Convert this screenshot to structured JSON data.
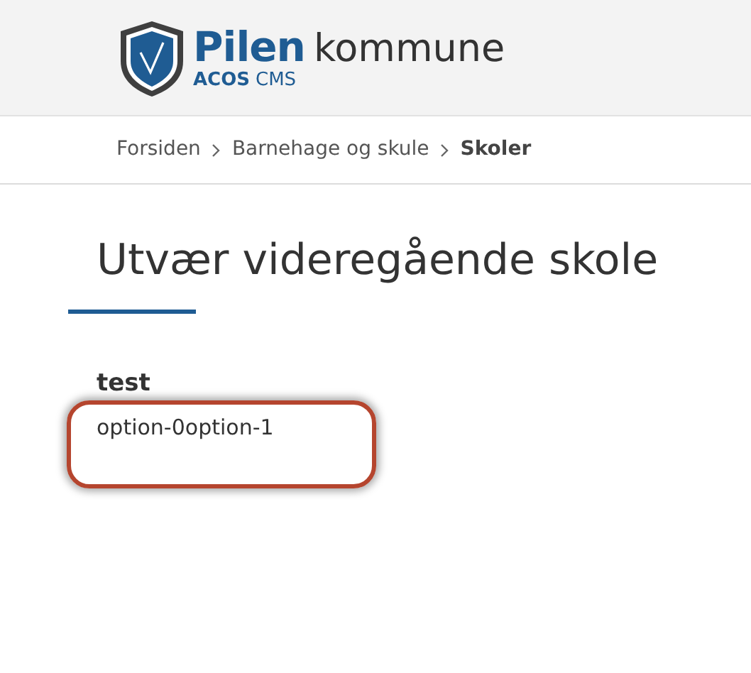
{
  "header": {
    "logo": {
      "name": "Pilen",
      "suffix": "kommune",
      "product_bold": "ACOS",
      "product": "CMS"
    }
  },
  "breadcrumb": [
    {
      "label": "Forsiden",
      "current": false
    },
    {
      "label": "Barnehage og skule",
      "current": false
    },
    {
      "label": "Skoler",
      "current": true
    }
  ],
  "page": {
    "title": "Utvær videregående skole",
    "field_label": "test",
    "field_value": "option-0option-1"
  }
}
